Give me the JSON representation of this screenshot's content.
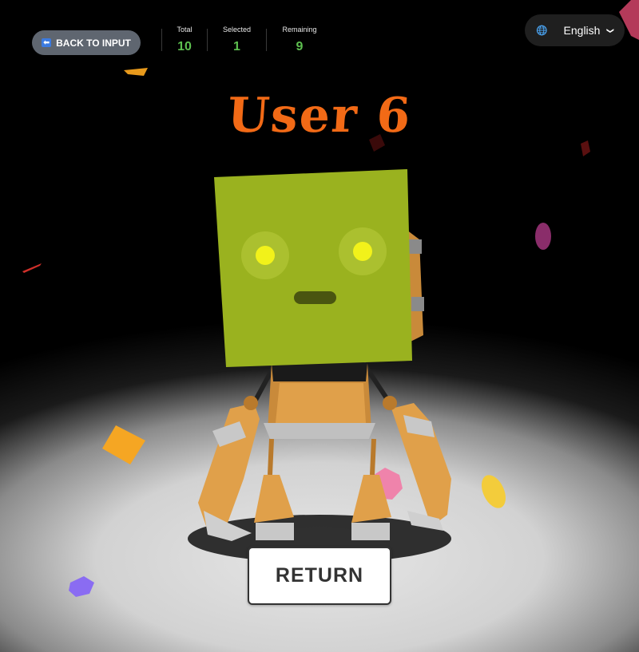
{
  "header": {
    "back_label": "BACK TO INPUT",
    "stats": [
      {
        "label": "Total",
        "value": "10"
      },
      {
        "label": "Selected",
        "value": "1"
      },
      {
        "label": "Remaining",
        "value": "9"
      }
    ],
    "language": {
      "selected": "English",
      "icon": "globe-icon"
    }
  },
  "result": {
    "name": "User 6"
  },
  "actions": {
    "return_label": "RETURN"
  },
  "colors": {
    "title": "#f26a16",
    "stat_value": "#5dbf4f",
    "robot_head": "#9ab21f",
    "robot_eye": "#f2f21a",
    "robot_body": "#e0a04a"
  }
}
